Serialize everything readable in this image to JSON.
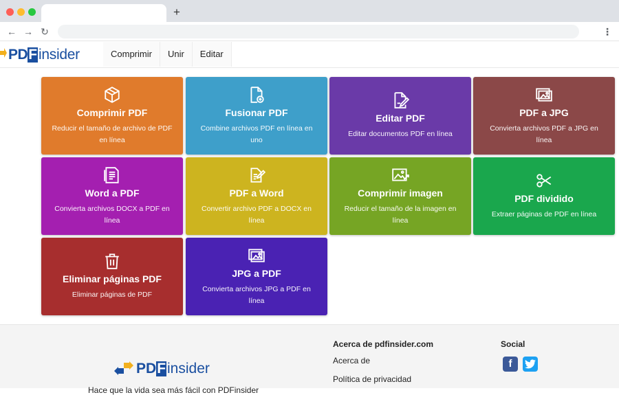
{
  "browser": {
    "new_tab_glyph": "+",
    "back_glyph": "←",
    "forward_glyph": "→",
    "reload_glyph": "↻",
    "menu_glyph": "⋮"
  },
  "header": {
    "logo": {
      "part1": "PD",
      "part2": "F",
      "part3": "insider"
    },
    "nav": [
      "Comprimir",
      "Unir",
      "Editar"
    ]
  },
  "tools": [
    {
      "title": "Comprimir PDF",
      "desc": "Reducir el tamaño de archivo de PDF en línea",
      "color": "#e07b2c",
      "icon": "cube-icon"
    },
    {
      "title": "Fusionar PDF",
      "desc": "Combine archivos PDF en línea en uno",
      "color": "#3e9fca",
      "icon": "file-plus-icon"
    },
    {
      "title": "Editar PDF",
      "desc": "Editar documentos PDF en línea",
      "color": "#6a3aa8",
      "icon": "file-edit-icon"
    },
    {
      "title": "PDF a JPG",
      "desc": "Convierta archivos PDF a JPG en línea",
      "color": "#8b4848",
      "icon": "images-icon"
    },
    {
      "title": "Word a PDF",
      "desc": "Convierta archivos DOCX a PDF en línea",
      "color": "#a41fb0",
      "icon": "document-icon"
    },
    {
      "title": "PDF a Word",
      "desc": "Convertir archivo PDF a DOCX en línea",
      "color": "#cdb41f",
      "icon": "file-pen-icon"
    },
    {
      "title": "Comprimir imagen",
      "desc": "Reducir el tamaño de la imagen en línea",
      "color": "#76a524",
      "icon": "image-compress-icon"
    },
    {
      "title": "PDF dividido",
      "desc": "Extraer páginas de PDF en línea",
      "color": "#1aa74d",
      "icon": "scissors-icon"
    },
    {
      "title": "Eliminar páginas PDF",
      "desc": "Eliminar páginas de PDF",
      "color": "#a72e2e",
      "icon": "trash-icon"
    },
    {
      "title": "JPG a PDF",
      "desc": "Convierta archivos JPG a PDF en línea",
      "color": "#4a22b3",
      "icon": "images-icon"
    }
  ],
  "footer": {
    "tagline": "Hace que la vida sea más fácil con PDFinsider",
    "about_heading": "Acerca de pdfinsider.com",
    "about_links": [
      "Acerca de",
      "Política de privacidad"
    ],
    "social_heading": "Social",
    "social": [
      {
        "name": "facebook",
        "glyph": "f"
      },
      {
        "name": "twitter",
        "glyph": "t"
      }
    ]
  }
}
